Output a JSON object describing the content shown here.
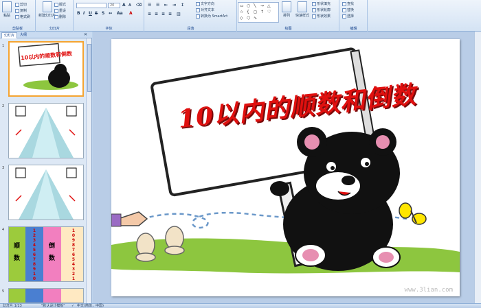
{
  "ribbon": {
    "clipboard": {
      "label": "剪贴板",
      "paste": "粘贴",
      "cut": "剪切",
      "copy": "复制",
      "format_painter": "格式刷"
    },
    "slides": {
      "label": "幻灯片",
      "new_slide": "新建幻灯片",
      "layout": "版式",
      "reset": "重设",
      "delete": "删除"
    },
    "font": {
      "label": "字体",
      "font_size": "20"
    },
    "paragraph": {
      "label": "段落",
      "text_direction": "文字方向",
      "align_text": "对齐文本",
      "smartart": "转换为 SmartArt"
    },
    "drawing": {
      "label": "绘图",
      "arrange": "排列",
      "quick_styles": "快速样式",
      "shape_fill": "形状填充",
      "shape_outline": "形状轮廓",
      "shape_effects": "形状效果"
    },
    "editing": {
      "label": "编辑",
      "find": "查找",
      "replace": "替换",
      "select": "选择"
    }
  },
  "left_pane": {
    "tabs": [
      "幻灯片",
      "大纲"
    ],
    "thumbs": [
      {
        "num": "1",
        "title": "10以内的顺数和倒数"
      },
      {
        "num": "2"
      },
      {
        "num": "3"
      },
      {
        "num": "4",
        "cols": [
          "顺",
          "数",
          "倒",
          "数"
        ],
        "seq_up": "1 2 3 4 5 6 7 8 9 10",
        "seq_down": "10 9 8 7 6 5 4 3 2 1"
      },
      {
        "num": "5"
      }
    ]
  },
  "slide": {
    "title": "10以内的顺数和倒数",
    "watermark": "www.3lian.com"
  },
  "status": {
    "slide_count": "幻灯片 1/23",
    "theme": "\"默认设计模板\"",
    "language": "中文(简体，中国)"
  },
  "colors": {
    "title_red": "#e0100f",
    "ribbon_blue": "#d4e3f4",
    "selection_orange": "#f5a431"
  }
}
